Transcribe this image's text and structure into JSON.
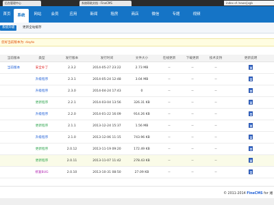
{
  "browser": {
    "tabs": [
      {
        "label": "后台管理中心"
      },
      {
        "label": "系统帮助文档 - FineCMS"
      }
    ],
    "address": "index of /news/jxgb"
  },
  "nav": {
    "items": [
      "首页",
      "系统",
      "网站",
      "会员",
      "应用",
      "新闻",
      "租房",
      "商店",
      "微信",
      "专题",
      "视频"
    ],
    "active": "系统"
  },
  "subnav": {
    "items": [
      "系统升级",
      "更新全站缓存"
    ],
    "active": "系统升级"
  },
  "notice": "您好当前版本为: dayto",
  "table": {
    "headers": [
      "当前版本",
      "类型",
      "发行版本",
      "发行时间",
      "文件大小",
      "在线更新",
      "下载更新",
      "技术支持",
      "更新说明"
    ],
    "rows": [
      {
        "current": "当前版本",
        "type": "安全补丁",
        "type_color": "red",
        "version": "2.3.2",
        "time": "2014-05-27 23:22",
        "size": "2.73 MB",
        "online": "--",
        "download": "--",
        "support": "--"
      },
      {
        "current": "",
        "type": "升级程序",
        "type_color": "blue",
        "version": "2.3.1",
        "time": "2014-05-24 12:48",
        "size": "3.04 MB",
        "online": "--",
        "download": "--",
        "support": "--"
      },
      {
        "current": "",
        "type": "升级程序",
        "type_color": "blue",
        "version": "2.3.0",
        "time": "2014-04-24 17:43",
        "size": "0",
        "online": "--",
        "download": "--",
        "support": "--"
      },
      {
        "current": "",
        "type": "更新程序",
        "type_color": "green",
        "version": "2.2.1",
        "time": "2014-03-04 13:56",
        "size": "326.31 KB",
        "online": "--",
        "download": "--",
        "support": "--"
      },
      {
        "current": "",
        "type": "升级程序",
        "type_color": "blue",
        "version": "2.2.0",
        "time": "2014-01-22 16:09",
        "size": "914.26 KB",
        "online": "--",
        "download": "--",
        "support": "--"
      },
      {
        "current": "",
        "type": "更新程序",
        "type_color": "green",
        "version": "2.1.1",
        "time": "2013-12-24 15:37",
        "size": "1.56 MB",
        "online": "--",
        "download": "--",
        "support": "--"
      },
      {
        "current": "",
        "type": "升级程序",
        "type_color": "blue",
        "version": "2.1.0",
        "time": "2013-12-06 11:15",
        "size": "743.96 KB",
        "online": "--",
        "download": "--",
        "support": "--"
      },
      {
        "current": "",
        "type": "更新程序",
        "type_color": "green",
        "version": "2.0.12",
        "time": "2013-11-19 09:20",
        "size": "172.49 KB",
        "online": "--",
        "download": "--",
        "support": "--"
      },
      {
        "current": "",
        "type": "更新程序",
        "type_color": "green",
        "version": "2.0.11",
        "time": "2013-11-07 11:42",
        "size": "278.43 KB",
        "online": "--",
        "download": "--",
        "support": "--",
        "highlight": true
      },
      {
        "current": "",
        "type": "修复BUG",
        "type_color": "purple",
        "version": "2.0.10",
        "time": "2013-10-31 08:50",
        "size": "27.09 KB",
        "online": "--",
        "download": "--",
        "support": "--"
      }
    ]
  },
  "footer": {
    "copyright": "© 2011-2014",
    "brand": "FineCMS",
    "suffix": "for 湘"
  },
  "icons": {
    "doc": "document-icon"
  }
}
